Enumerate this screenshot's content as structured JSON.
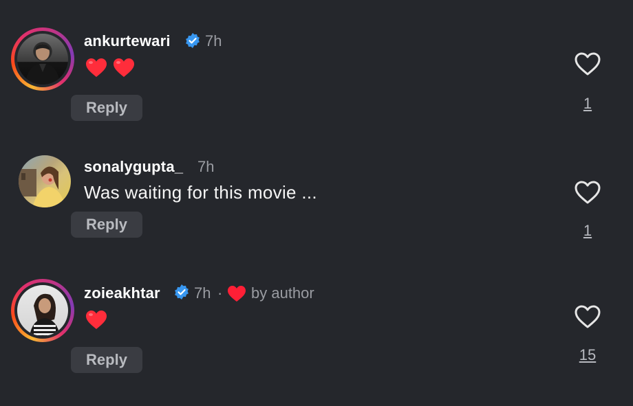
{
  "comments": [
    {
      "username": "ankurtewari",
      "verified": true,
      "time": "7h",
      "text": "",
      "emoji": [
        "red-heart",
        "red-heart"
      ],
      "reply_label": "Reply",
      "like_count": "1",
      "story_ring": true
    },
    {
      "username": "sonalygupta_",
      "verified": false,
      "time": "7h",
      "text": "Was waiting for this movie ...",
      "emoji": [],
      "reply_label": "Reply",
      "like_count": "1",
      "story_ring": false
    },
    {
      "username": "zoieakhtar",
      "verified": true,
      "time": "7h",
      "separator": "·",
      "liked_by_author": "by author",
      "text": "",
      "emoji": [
        "red-heart"
      ],
      "reply_label": "Reply",
      "like_count": "15",
      "story_ring": true
    }
  ],
  "colors": {
    "background": "#25272c",
    "verified_blue": "#3897f0",
    "heart_red": "#ff2d3b"
  }
}
